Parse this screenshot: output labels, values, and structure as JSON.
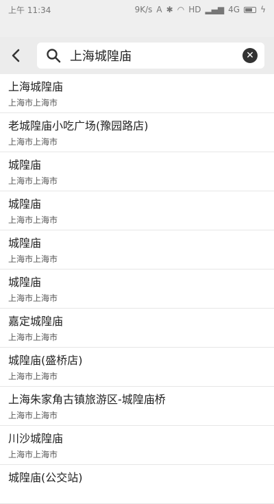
{
  "status_bar": {
    "time": "上午 11:34",
    "network_speed": "9K/s",
    "hd": "HD",
    "signal": "4G"
  },
  "search": {
    "back_icon": "back-arrow-icon",
    "search_icon": "search-icon",
    "query": "上海城隍庙",
    "clear_icon": "clear-icon"
  },
  "results": [
    {
      "title": "上海城隍庙",
      "subtitle": "上海市上海市"
    },
    {
      "title": "老城隍庙小吃广场(豫园路店)",
      "subtitle": "上海市上海市"
    },
    {
      "title": "城隍庙",
      "subtitle": "上海市上海市"
    },
    {
      "title": "城隍庙",
      "subtitle": "上海市上海市"
    },
    {
      "title": "城隍庙",
      "subtitle": "上海市上海市"
    },
    {
      "title": "城隍庙",
      "subtitle": "上海市上海市"
    },
    {
      "title": "嘉定城隍庙",
      "subtitle": "上海市上海市"
    },
    {
      "title": "城隍庙(盛桥店)",
      "subtitle": "上海市上海市"
    },
    {
      "title": "上海朱家角古镇旅游区-城隍庙桥",
      "subtitle": "上海市上海市"
    },
    {
      "title": "川沙城隍庙",
      "subtitle": "上海市上海市"
    },
    {
      "title": "城隍庙(公交站)",
      "subtitle": ""
    }
  ]
}
